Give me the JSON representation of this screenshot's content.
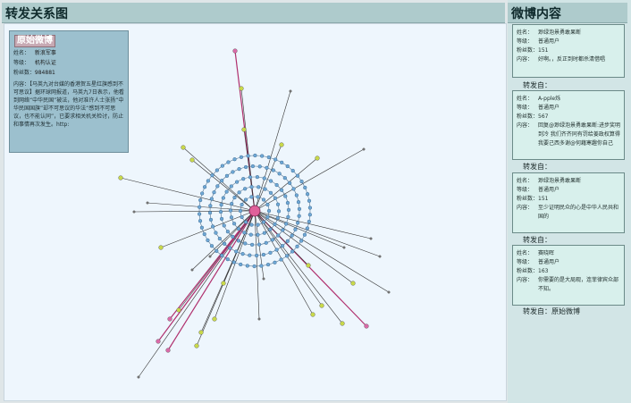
{
  "left_panel": {
    "title": "转发关系图"
  },
  "original_post": {
    "title": "原始微博",
    "fields": [
      {
        "label": "姓名：",
        "value": "新浪军事"
      },
      {
        "label": "等级：",
        "value": "机构认证"
      },
      {
        "label": "粉丝数：",
        "value": "984881"
      }
    ],
    "content_label": "内容：",
    "content": "【马英九对台媒的香港贺五星红旗感到不可思议】据环球网报道，马英九7日表示，他看到网络“中华民国”被法，他对准许人士张扬“中华民国国旗”却不可思议的华法“感到不可思议，也不能认同”，已要求相关机关检讨，防止和事情再次发生。http:"
  },
  "right_panel": {
    "title": "微博内容",
    "cards": [
      {
        "name_label": "姓名：",
        "name": "渺绿泡景勇敢果断",
        "level_label": "等级：",
        "level": "普通用户",
        "fans_label": "粉丝数：",
        "fans": "151",
        "content_label": "内容：",
        "content": "好啊。，反正到时都杀清借唱"
      },
      {
        "name_label": "姓名：",
        "name": "A-pple烁",
        "level_label": "等级：",
        "level": "普通用户",
        "fans_label": "粉丝数：",
        "fans": "567",
        "content_label": "内容：",
        "content": "回复@渺绿泡景勇敢果断:进步奖明到冷 我们齐齐同有罚给姜政权算得 我要己西多谢@何藉寒趣你自己"
      },
      {
        "name_label": "姓名：",
        "name": "渺绿泡景勇敢果断",
        "level_label": "等级：",
        "level": "普通用户",
        "fans_label": "粉丝数：",
        "fans": "151",
        "content_label": "内容：",
        "content": "至少证明民众的心是中华人民共和国的"
      },
      {
        "name_label": "姓名：",
        "name": "赛晓晖",
        "level_label": "等级：",
        "level": "普通用户",
        "fans_label": "粉丝数：",
        "fans": "163",
        "content_label": "内容：",
        "content": "你需要的是大局观，连菲律宾众部不知。"
      }
    ],
    "forward_labels": [
      "转发自：",
      "转发自：",
      "转发自：",
      "转发自：原始微博"
    ]
  },
  "colors": {
    "header": "#aecbcc",
    "graph_bg": "#eef6fd",
    "ring_node": "#6fa8d6",
    "center_node": "#e0609a",
    "leaf_yellow": "#c8d84a",
    "leaf_pink": "#d96aa8",
    "card_bg": "#d8f0ec"
  }
}
